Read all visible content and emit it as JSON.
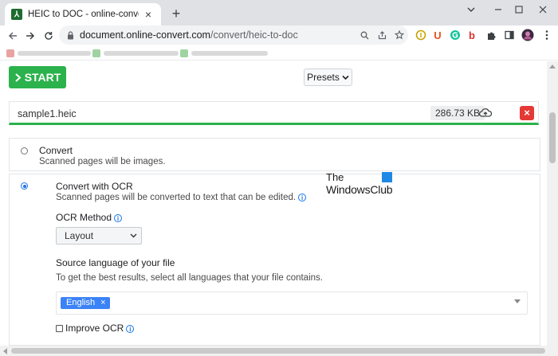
{
  "browser": {
    "tab_title": "HEIC to DOC - online-convert.co",
    "tab_close": "×",
    "new_tab": "+",
    "url_host": "document.online-convert.com",
    "url_path": "/convert/heic-to-doc"
  },
  "page": {
    "start_label": "START",
    "presets_label": "Presets",
    "file": {
      "name": "sample1.heic",
      "size": "286.73 KB",
      "remove": "×"
    },
    "options": [
      {
        "title": "Convert",
        "description": "Scanned pages will be images.",
        "selected": false
      },
      {
        "title": "Convert with OCR",
        "description": "Scanned pages will be converted to text that can be edited.",
        "selected": true
      }
    ],
    "ocr_method": {
      "label": "OCR Method",
      "value": "Layout"
    },
    "source_language": {
      "label": "Source language of your file",
      "hint": "To get the best results, select all languages that your file contains.",
      "tags": [
        "English"
      ],
      "tag_remove": "×"
    },
    "improve_ocr": {
      "label": "Improve OCR",
      "checked": false
    }
  },
  "watermark": {
    "line1": "The",
    "line2": "WindowsClub"
  },
  "colors": {
    "start_green": "#2bb24c",
    "remove_red": "#e53935",
    "tag_blue": "#3b82f6",
    "info_blue": "#1a73e8"
  }
}
